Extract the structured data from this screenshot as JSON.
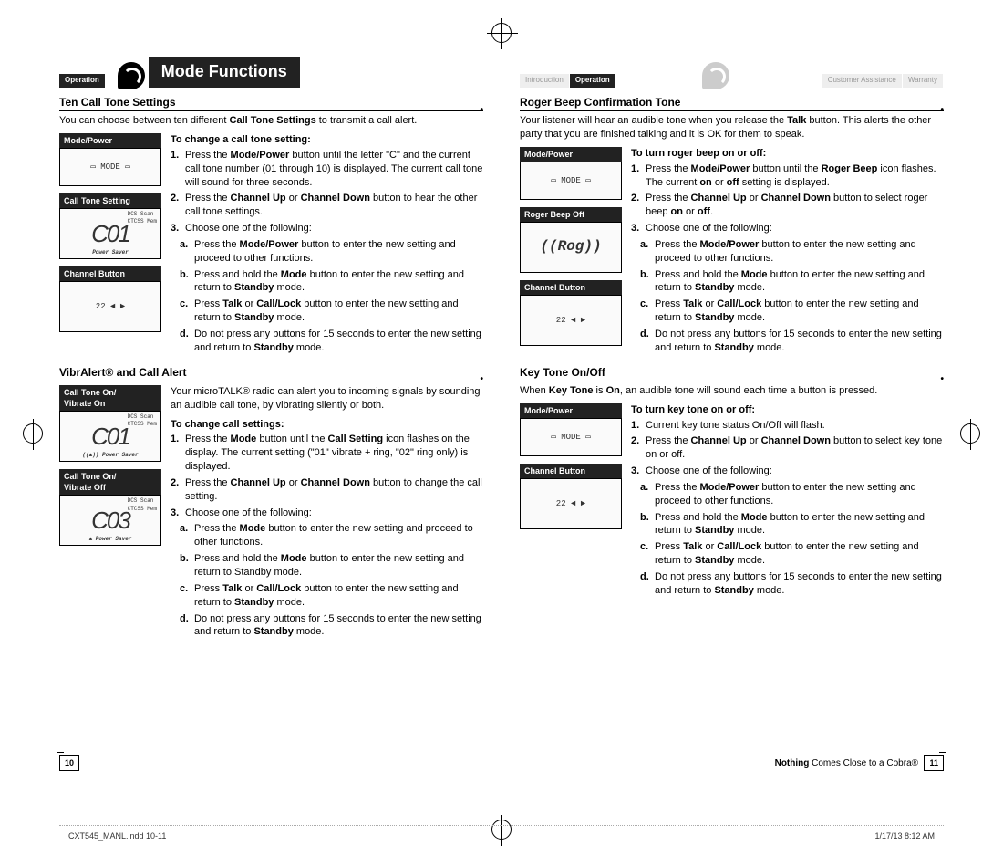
{
  "header": {
    "operation_tab": "Operation",
    "title": "Mode Functions",
    "breadcrumb": [
      "Introduction",
      "Operation",
      "Customer Assistance",
      "Warranty"
    ]
  },
  "left_page": {
    "page_num": "10",
    "section1": {
      "heading": "Ten Call Tone Settings",
      "intro_pre": "You can choose between ten different ",
      "intro_bold": "Call Tone Settings",
      "intro_post": " to transmit a call alert.",
      "proc_title": "To change a call tone setting:",
      "panels": {
        "p1": "Mode/Power",
        "p2": "Call Tone Setting",
        "p3": "Channel Button",
        "lcd_value": "01"
      },
      "steps": {
        "s1_pre": "Press the ",
        "s1_b1": "Mode/Power",
        "s1_post": " button until the letter \"C\" and the current call tone number (01 through 10) is displayed. The current call tone will sound for three seconds.",
        "s2_pre": "Press the ",
        "s2_b1": "Channel Up",
        "s2_mid": " or ",
        "s2_b2": "Channel Down",
        "s2_post": " button to hear the other call tone settings.",
        "s3": "Choose one of the following:",
        "sa_pre": "Press the ",
        "sa_b": "Mode/Power",
        "sa_post": " button to enter the new setting and proceed to other functions.",
        "sb_pre": "Press and hold the ",
        "sb_b": "Mode",
        "sb_mid": " button to enter the new setting and return to ",
        "sb_b2": "Standby",
        "sb_post": " mode.",
        "sc_pre": "Press ",
        "sc_b1": "Talk",
        "sc_mid": " or ",
        "sc_b2": "Call/Lock",
        "sc_mid2": " button to enter the new setting and return to ",
        "sc_b3": "Standby",
        "sc_post": " mode.",
        "sd_pre": "Do not press any buttons for 15 seconds to enter the new setting and return to ",
        "sd_b": "Standby",
        "sd_post": " mode."
      }
    },
    "section2": {
      "heading": "VibrAlert® and Call Alert",
      "intro": "Your microTALK® radio can alert you to incoming signals by sounding an audible call tone, by vibrating silently or both.",
      "proc_title": "To change call settings:",
      "panels": {
        "p1": "Call Tone On/\nVibrate On",
        "p2": "Call Tone On/\nVibrate Off",
        "lcd1": "01",
        "lcd2": "03"
      },
      "steps": {
        "s1_pre": "Press the ",
        "s1_b1": "Mode",
        "s1_mid": " button until the ",
        "s1_b2": "Call Setting",
        "s1_post": " icon flashes on the display. The current setting (\"01\" vibrate + ring, \"02\" ring only) is displayed.",
        "s2_pre": "Press the ",
        "s2_b1": "Channel Up",
        "s2_mid": " or ",
        "s2_b2": "Channel Down",
        "s2_post": " button to change the call setting.",
        "s3": "Choose one of the following:",
        "sa_pre": "Press the ",
        "sa_b": "Mode",
        "sa_post": " button to enter the new setting and proceed to other functions.",
        "sb_pre": "Press and hold the ",
        "sb_b": "Mode",
        "sb_post": " button to enter the new setting and return to Standby mode.",
        "sc_pre": "Press ",
        "sc_b1": "Talk",
        "sc_mid": " or ",
        "sc_b2": "Call/Lock",
        "sc_mid2": " button to enter the new setting and return to ",
        "sc_b3": "Standby",
        "sc_post": " mode.",
        "sd_pre": "Do not press any buttons for 15 seconds to enter the new setting and return to ",
        "sd_b": "Standby",
        "sd_post": " mode."
      }
    }
  },
  "right_page": {
    "page_num": "11",
    "tagline_b": "Nothing",
    "tagline_rest": " Comes Close to a Cobra®",
    "section1": {
      "heading": "Roger Beep Confirmation Tone",
      "intro_pre": "Your listener will hear an audible tone when you release the ",
      "intro_b": "Talk",
      "intro_post": " button. This alerts the other party that you are finished talking and it is OK for them to speak.",
      "proc_title": "To turn roger beep on or off:",
      "panels": {
        "p1": "Mode/Power",
        "p2": "Roger Beep Off",
        "p3": "Channel Button",
        "lcd": "Rog"
      },
      "steps": {
        "s1_pre": "Press the ",
        "s1_b1": "Mode/Power",
        "s1_mid": " button until the ",
        "s1_b2": "Roger Beep",
        "s1_mid2": " icon flashes. The current ",
        "s1_b3": "on",
        "s1_mid3": " or ",
        "s1_b4": "off",
        "s1_post": " setting is displayed.",
        "s2_pre": "Press the ",
        "s2_b1": "Channel Up",
        "s2_mid": " or ",
        "s2_b2": "Channel Down",
        "s2_mid2": " button to select roger beep ",
        "s2_b3": "on",
        "s2_mid3": " or ",
        "s2_b4": "off",
        "s2_post": ".",
        "s3": "Choose one of the following:",
        "sa_pre": "Press the ",
        "sa_b": "Mode/Power",
        "sa_post": " button to enter the new setting and proceed to other functions.",
        "sb_pre": "Press and hold the ",
        "sb_b": "Mode",
        "sb_mid": " button to enter the new setting and return to ",
        "sb_b2": "Standby",
        "sb_post": " mode.",
        "sc_pre": "Press ",
        "sc_b1": "Talk",
        "sc_mid": " or ",
        "sc_b2": "Call/Lock",
        "sc_mid2": " button to enter the new setting and return to ",
        "sc_b3": "Standby",
        "sc_post": " mode.",
        "sd_pre": "Do not press any buttons for 15 seconds to enter the new setting and return to ",
        "sd_b": "Standby",
        "sd_post": " mode."
      }
    },
    "section2": {
      "heading": "Key Tone On/Off",
      "intro_pre": "When ",
      "intro_b1": "Key Tone",
      "intro_mid": " is ",
      "intro_b2": "On",
      "intro_post": ", an audible tone will sound each time a button is pressed.",
      "proc_title": "To turn key tone on or off:",
      "panels": {
        "p1": "Mode/Power",
        "p2": "Channel Button"
      },
      "steps": {
        "s1": "Current key tone status On/Off will flash.",
        "s2_pre": "Press the ",
        "s2_b1": "Channel Up",
        "s2_mid": " or ",
        "s2_b2": "Channel Down",
        "s2_post": " button to select key tone on or off.",
        "s3": "Choose one of the following:",
        "sa_pre": "Press the ",
        "sa_b": "Mode/Power",
        "sa_post": " button to enter the new setting and proceed to other functions.",
        "sb_pre": "Press and hold the ",
        "sb_b": "Mode",
        "sb_mid": " button to enter the new setting and return to ",
        "sb_b2": "Standby",
        "sb_post": " mode.",
        "sc_pre": "Press ",
        "sc_b1": "Talk",
        "sc_mid": " or ",
        "sc_b2": "Call/Lock",
        "sc_mid2": " button to enter the new setting and return to ",
        "sc_b3": "Standby",
        "sc_post": " mode.",
        "sd_pre": "Do not press any buttons for 15 seconds to enter the new setting and return to ",
        "sd_b": "Standby",
        "sd_post": " mode."
      }
    }
  },
  "footer": {
    "file": "CXT545_MANL.indd   10-11",
    "date": "1/17/13   8:12 AM"
  }
}
